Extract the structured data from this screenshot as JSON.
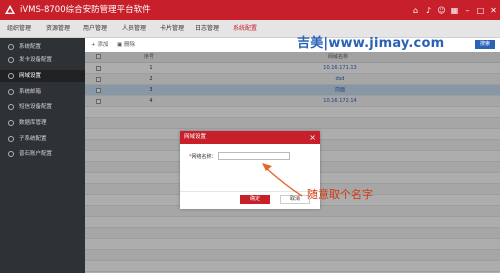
{
  "app": {
    "title": "iVMS-8700综合安防管理平台软件"
  },
  "top_icons": [
    "home-icon",
    "bell-icon",
    "user-icon",
    "grid-icon",
    "minimize-icon",
    "maximize-icon",
    "close-icon"
  ],
  "menu": {
    "items": [
      {
        "label": "组织管理",
        "active": false
      },
      {
        "label": "资源管理",
        "active": false
      },
      {
        "label": "用户管理",
        "active": false
      },
      {
        "label": "人员管理",
        "active": false
      },
      {
        "label": "卡片管理",
        "active": false
      },
      {
        "label": "日志管理",
        "active": false
      },
      {
        "label": "系统配置",
        "active": true
      }
    ]
  },
  "sidebar": {
    "items": [
      {
        "label": "系统配置",
        "active": false
      },
      {
        "label": "发卡设备配置",
        "active": false
      },
      {
        "label": "网域设置",
        "active": true
      },
      {
        "label": "系统邮箱",
        "active": false
      },
      {
        "label": "短信设备配置",
        "active": false
      },
      {
        "label": "数据库管理",
        "active": false
      },
      {
        "label": "子系统配置",
        "active": false
      },
      {
        "label": "普石账户配置",
        "active": false
      }
    ]
  },
  "toolbar": {
    "add_label": "添加",
    "delete_label": "删除",
    "search_label": "搜索"
  },
  "watermark": "吉美|www.jimay.com",
  "table": {
    "headers": {
      "num": "序号",
      "addr": "网域名称"
    },
    "rows": [
      {
        "num": "1",
        "addr": "10.16.171.13"
      },
      {
        "num": "2",
        "addr": "dsd"
      },
      {
        "num": "3",
        "addr": "前面"
      },
      {
        "num": "4",
        "addr": "10.16.172.14"
      }
    ]
  },
  "dialog": {
    "title": "网域设置",
    "field_label": "网络名称：",
    "field_required": "*",
    "field_value": "",
    "ok_label": "确定",
    "cancel_label": "取消"
  },
  "annotation": {
    "text": "随意取个名字",
    "color": "#d4380d"
  },
  "colors": {
    "brand": "#c8202a",
    "link": "#2a62b8",
    "sidebar_bg": "#2f3235",
    "selected_row": "#c9dff5"
  }
}
